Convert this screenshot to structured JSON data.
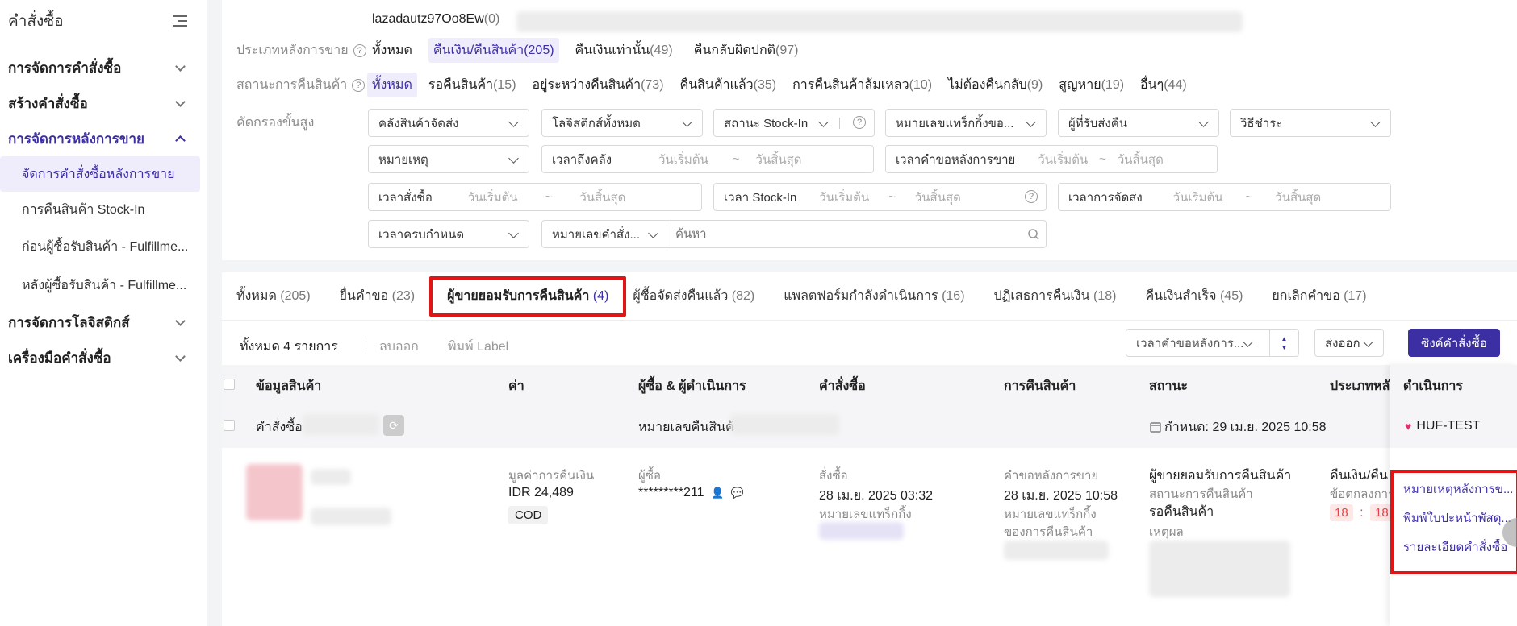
{
  "sidebar": {
    "title": "คำสั่งซื้อ",
    "groups": [
      {
        "label": "การจัดการคำสั่งซื้อ"
      },
      {
        "label": "สร้างคำสั่งซื้อ"
      },
      {
        "label": "การจัดการหลังการขาย"
      },
      {
        "label": "การจัดการโลจิสติกส์"
      },
      {
        "label": "เครื่องมือคำสั่งซื้อ"
      }
    ],
    "subs": [
      {
        "label": "จัดการคำสั่งซื้อหลังการขาย"
      },
      {
        "label": "การคืนสินค้า Stock-In"
      },
      {
        "label": "ก่อนผู้ซื้อรับสินค้า - Fulfillme..."
      },
      {
        "label": "หลังผู้ซื้อรับสินค้า - Fulfillme..."
      }
    ]
  },
  "filters": {
    "store_name": "lazadautz97Oo8Ew",
    "store_count": "(0)",
    "aftersale_type_label": "ประเภทหลังการขาย",
    "aftersale_types": [
      {
        "label": "ทั้งหมด",
        "count": ""
      },
      {
        "label": "คืนเงิน/คืนสินค้า",
        "count": "(205)"
      },
      {
        "label": "คืนเงินเท่านั้น",
        "count": "(49)"
      },
      {
        "label": "คืนกลับผิดปกติ",
        "count": "(97)"
      }
    ],
    "return_status_label": "สถานะการคืนสินค้า",
    "return_statuses": [
      {
        "label": "ทั้งหมด",
        "count": ""
      },
      {
        "label": "รอคืนสินค้า",
        "count": "(15)"
      },
      {
        "label": "อยู่ระหว่างคืนสินค้า",
        "count": "(73)"
      },
      {
        "label": "คืนสินค้าแล้ว",
        "count": "(35)"
      },
      {
        "label": "การคืนสินค้าล้มเหลว",
        "count": "(10)"
      },
      {
        "label": "ไม่ต้องคืนกลับ",
        "count": "(9)"
      },
      {
        "label": "สูญหาย",
        "count": "(19)"
      },
      {
        "label": "อื่นๆ",
        "count": "(44)"
      }
    ],
    "advanced_label": "คัดกรองขั้นสูง",
    "warehouse": "คลังสินค้าจัดส่ง",
    "logistics": "โลจิสติกส์ทั้งหมด",
    "stockin_status": "สถานะ Stock-In",
    "tracking_placeholder": "หมายเลขแทร็กกิ้งขอ...",
    "receiver": "ผู้ที่รับส่งคืน",
    "payment": "วิธีชำระ",
    "reason": "หมายเหตุ",
    "warehouse_time": "เวลาถึงคลัง",
    "aftersale_request_time": "เวลาคำขอหลังการขาย",
    "order_time": "เวลาสั่งซื้อ",
    "stockin_time": "เวลา Stock-In",
    "ship_time": "เวลาการจัดส่ง",
    "deadline": "เวลาครบกำหนด",
    "order_no_type": "หมายเลขคำสั่ง...",
    "search_placeholder": "ค้นหา",
    "start_date": "วันเริ่มต้น",
    "end_date": "วันสิ้นสุด",
    "tilde": "~"
  },
  "tabs": [
    {
      "label": "ทั้งหมด",
      "count": "(205)"
    },
    {
      "label": "ยื่นคำขอ",
      "count": "(23)"
    },
    {
      "label": "ผู้ขายยอมรับการคืนสินค้า",
      "count": "(4)"
    },
    {
      "label": "ผู้ซื้อจัดส่งคืนแล้ว",
      "count": "(82)"
    },
    {
      "label": "แพลตฟอร์มกำลังดำเนินการ",
      "count": "(16)"
    },
    {
      "label": "ปฏิเสธการคืนเงิน",
      "count": "(18)"
    },
    {
      "label": "คืนเงินสำเร็จ",
      "count": "(45)"
    },
    {
      "label": "ยกเลิกคำขอ",
      "count": "(17)"
    }
  ],
  "toolbar": {
    "total": "ทั้งหมด 4 รายการ",
    "delete": "ลบออก",
    "print_label": "พิมพ์ Label",
    "sort": "เวลาคำขอหลังการ...",
    "export": "ส่งออก",
    "sync": "ซิงค์คำสั่งซื้อ"
  },
  "table": {
    "headers": {
      "product": "ข้อมูลสินค้า",
      "price": "ค่า",
      "buyer": "ผู้ซื้อ & ผู้ดำเนินการ",
      "order": "คำสั่งซื้อ",
      "return": "การคืนสินค้า",
      "status": "สถานะ",
      "type": "ประเภทหลัง",
      "action": "ดำเนินการ"
    },
    "subrow": {
      "order_label": "คำสั่งซื้อ",
      "return_no_label": "หมายเลขคืนสินค้า",
      "deadline": "กำหนด:  29 เม.ย. 2025 10:58",
      "shop": "HUF-TEST"
    },
    "row": {
      "refund_label": "มูลค่าการคืนเงิน",
      "refund_value": "IDR 24,489",
      "payment": "COD",
      "buyer_label": "ผู้ซื้อ",
      "buyer_value": "*********211",
      "order_label": "สั่งซื้อ",
      "order_time": "28 เม.ย. 2025 03:32",
      "tracking_label": "หมายเลขแทร็กกิ้ง",
      "request_label": "คำขอหลังการขาย",
      "request_time": "28 เม.ย. 2025 10:58",
      "return_tracking_label_1": "หมายเลขแทร็กกิ้ง",
      "return_tracking_label_2": "ของการคืนสินค้า",
      "status_title": "ผู้ขายยอมรับการคืนสินค้า",
      "return_status_label": "สถานะการคืนสินค้า",
      "return_status_value": "รอคืนสินค้า",
      "reason_label": "เหตุผล",
      "type_value": "คืนเงิน/คืน",
      "type_sub": "ข้อตกลงการ",
      "timer_a": "18",
      "timer_sep": ":",
      "timer_b": "18"
    },
    "actions": [
      {
        "label": "หมายเหตุหลังการข..."
      },
      {
        "label": "พิมพ์ใบปะหน้าพัสดุ..."
      },
      {
        "label": "รายละเอียดคำสั่งซื้อ"
      }
    ]
  },
  "colors": {
    "accent": "#3c2fa3",
    "highlight": "#e01515"
  }
}
